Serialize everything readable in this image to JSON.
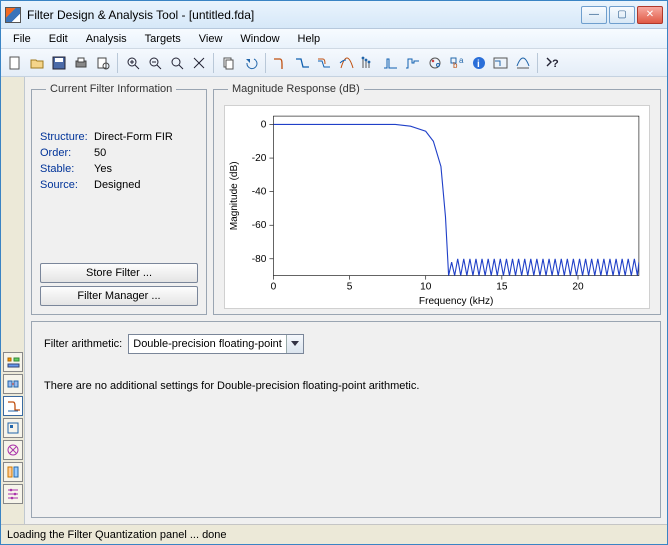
{
  "window": {
    "title": "Filter Design & Analysis Tool - [untitled.fda]"
  },
  "menu": {
    "file": "File",
    "edit": "Edit",
    "analysis": "Analysis",
    "targets": "Targets",
    "view": "View",
    "window": "Window",
    "help": "Help"
  },
  "toolbar_icons": {
    "new": "new",
    "open": "open",
    "save": "save",
    "print": "print",
    "print_preview": "print-preview",
    "zoom_in": "zoom-in",
    "zoom_out": "zoom-out",
    "zoom_full": "zoom-full",
    "zoom_xy": "zoom-xy",
    "copy": "copy",
    "undo": "undo",
    "mag": "magnitude",
    "phase": "phase",
    "magphase": "mag-phase",
    "groupdelay": "group-delay",
    "phasedelay": "phase-delay",
    "impulse": "impulse",
    "step": "step",
    "polezero": "pole-zero",
    "coef": "coefficients",
    "info": "info-blue",
    "filtspec": "filter-spec",
    "roundoff": "roundoff",
    "help": "help"
  },
  "info_panel": {
    "legend": "Current Filter Information",
    "rows": {
      "structure_label": "Structure:",
      "structure_value": "Direct-Form FIR",
      "order_label": "Order:",
      "order_value": "50",
      "stable_label": "Stable:",
      "stable_value": "Yes",
      "source_label": "Source:",
      "source_value": "Designed"
    },
    "store_btn": "Store Filter ...",
    "manager_btn": "Filter Manager ..."
  },
  "plot_panel": {
    "legend": "Magnitude Response (dB)",
    "xlabel": "Frequency (kHz)",
    "ylabel": "Magnitude (dB)",
    "xticks": [
      "0",
      "5",
      "10",
      "15",
      "20"
    ],
    "yticks": [
      "0",
      "-20",
      "-40",
      "-60",
      "-80"
    ]
  },
  "arith": {
    "label": "Filter arithmetic:",
    "value": "Double-precision floating-point",
    "msg": "There are no additional settings for Double-precision floating-point arithmetic."
  },
  "status": {
    "text": "Loading the Filter Quantization panel ... done"
  },
  "chart_data": {
    "type": "line",
    "title": "Magnitude Response (dB)",
    "xlabel": "Frequency (kHz)",
    "ylabel": "Magnitude (dB)",
    "xlim": [
      0,
      24
    ],
    "ylim": [
      -90,
      5
    ],
    "x": [
      0,
      1,
      2,
      3,
      4,
      5,
      6,
      7,
      8,
      9,
      10,
      10.5,
      11,
      11.3,
      11.5,
      11.7,
      11.9,
      12.1,
      12.3,
      12.5,
      12.7,
      12.9,
      13.1,
      13.3,
      13.5,
      13.7,
      13.9,
      14.1,
      14.3,
      14.5,
      14.7,
      14.9,
      15.1,
      15.3,
      15.5,
      15.7,
      15.9,
      16.1,
      16.3,
      16.5,
      16.7,
      16.9,
      17.1,
      17.3,
      17.5,
      17.7,
      17.9,
      18.1,
      18.3,
      18.5,
      18.7,
      18.9,
      19.1,
      19.3,
      19.5,
      19.7,
      19.9,
      20.1,
      20.3,
      20.5,
      20.7,
      20.9,
      21.1,
      21.3,
      21.5,
      21.7,
      21.9,
      22.1,
      22.3,
      22.5,
      22.7,
      22.9,
      23.1,
      23.3,
      23.5,
      23.7,
      23.9,
      24
    ],
    "y": [
      0,
      0,
      0,
      0,
      0,
      0,
      0,
      0,
      0,
      -1,
      -4,
      -10,
      -25,
      -55,
      -90,
      -82,
      -90,
      -80,
      -90,
      -80,
      -90,
      -80,
      -90,
      -80,
      -90,
      -80,
      -90,
      -80,
      -90,
      -80,
      -90,
      -80,
      -90,
      -80,
      -90,
      -80,
      -90,
      -80,
      -90,
      -80,
      -90,
      -80,
      -90,
      -80,
      -90,
      -80,
      -90,
      -80,
      -90,
      -80,
      -90,
      -80,
      -90,
      -80,
      -90,
      -80,
      -90,
      -80,
      -90,
      -80,
      -90,
      -80,
      -90,
      -80,
      -90,
      -80,
      -90,
      -80,
      -90,
      -80,
      -90,
      -80,
      -90,
      -80,
      -90,
      -80,
      -90,
      -82
    ]
  }
}
